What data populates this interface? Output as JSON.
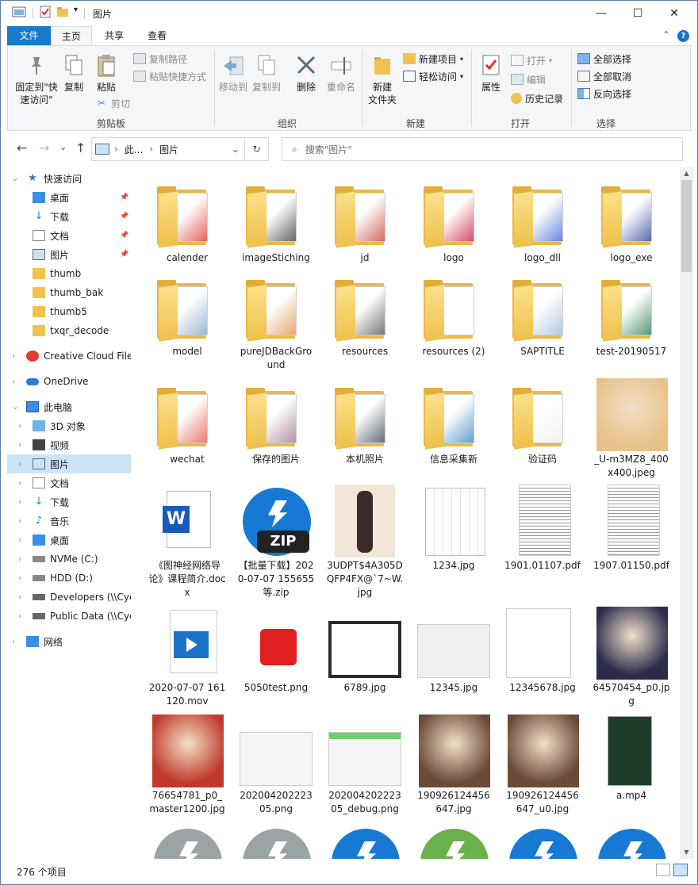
{
  "title_bar": {
    "title": "图片",
    "minimize": "—",
    "maximize": "☐",
    "close": "✕"
  },
  "ribbon_tabs": {
    "file": "文件",
    "home": "主页",
    "share": "共享",
    "view": "查看",
    "help": "?",
    "collapse": "⌃"
  },
  "ribbon": {
    "clipboard": {
      "label": "剪贴板",
      "pin_quick": "固定到\"快速访问\"",
      "copy": "复制",
      "paste": "粘贴",
      "copy_path": "复制路径",
      "paste_shortcut": "粘贴快捷方式",
      "cut": "剪切"
    },
    "organize": {
      "label": "组织",
      "move_to": "移动到",
      "copy_to": "复制到",
      "delete": "删除",
      "rename": "重命名"
    },
    "new": {
      "label": "新建",
      "new_folder": "新建\n文件夹",
      "new_item": "新建项目",
      "easy_access": "轻松访问"
    },
    "open": {
      "label": "打开",
      "properties": "属性",
      "open": "打开",
      "edit": "编辑",
      "history": "历史记录"
    },
    "select": {
      "label": "选择",
      "select_all": "全部选择",
      "select_none": "全部取消",
      "invert": "反向选择"
    }
  },
  "address": {
    "back": "←",
    "forward": "→",
    "recent": "⌄",
    "up": "↑",
    "crumb_sep": "›",
    "crumb_1": "此...",
    "crumb_2": "图片",
    "dropdown": "⌄",
    "refresh": "↻",
    "search_placeholder": "搜索\"图片\""
  },
  "nav": [
    {
      "label": "快速访问",
      "type": "quick",
      "expanded": true
    },
    {
      "label": "桌面",
      "type": "desktop",
      "pinned": true
    },
    {
      "label": "下载",
      "type": "download",
      "pinned": true
    },
    {
      "label": "文档",
      "type": "doc",
      "pinned": true
    },
    {
      "label": "图片",
      "type": "pic",
      "pinned": true
    },
    {
      "label": "thumb",
      "type": "folder"
    },
    {
      "label": "thumb_bak",
      "type": "folder"
    },
    {
      "label": "thumb5",
      "type": "folder"
    },
    {
      "label": "txqr_decode",
      "type": "folder"
    },
    {
      "label": "Creative Cloud Files",
      "type": "cc"
    },
    {
      "label": "OneDrive",
      "type": "onedrive"
    },
    {
      "label": "此电脑",
      "type": "pc",
      "expanded": true
    },
    {
      "label": "3D 对象",
      "type": "3d"
    },
    {
      "label": "视频",
      "type": "video"
    },
    {
      "label": "图片",
      "type": "pic",
      "selected": true
    },
    {
      "label": "文档",
      "type": "doc"
    },
    {
      "label": "下载",
      "type": "download"
    },
    {
      "label": "音乐",
      "type": "music"
    },
    {
      "label": "桌面",
      "type": "desktop"
    },
    {
      "label": "NVMe (C:)",
      "type": "drive"
    },
    {
      "label": "HDD (D:)",
      "type": "drive"
    },
    {
      "label": "Developers (\\\\Cyc",
      "type": "netdrive"
    },
    {
      "label": "Public Data (\\\\Cyc",
      "type": "netdrive"
    },
    {
      "label": "网络",
      "type": "network"
    }
  ],
  "items": [
    {
      "name": "calender",
      "kind": "folder",
      "accent": "#d93025"
    },
    {
      "name": "imageStiching",
      "kind": "folder",
      "accent": "#333333"
    },
    {
      "name": "jd",
      "kind": "folder",
      "accent": "#c0392b"
    },
    {
      "name": "logo",
      "kind": "folder",
      "accent": "#c8102e"
    },
    {
      "name": "logo_dll",
      "kind": "folder",
      "accent": "#3a5fcd"
    },
    {
      "name": "logo_exe",
      "kind": "folder",
      "accent": "#1f3a93"
    },
    {
      "name": "model",
      "kind": "folder",
      "accent": "#7aa0c4"
    },
    {
      "name": "pureJDBackGround",
      "kind": "folder",
      "accent": "#e08a3c"
    },
    {
      "name": "resources",
      "kind": "folder",
      "accent": "#4a4a4a"
    },
    {
      "name": "resources (2)",
      "kind": "folder",
      "accent": "#ffffff"
    },
    {
      "name": "SAPTITLE",
      "kind": "folder",
      "accent": "#9ab8d8"
    },
    {
      "name": "test-20190517",
      "kind": "folder",
      "accent": "#1e7145"
    },
    {
      "name": "wechat",
      "kind": "folder",
      "accent": "#e74c3c"
    },
    {
      "name": "保存的图片",
      "kind": "folder",
      "accent": "#9b6b8a"
    },
    {
      "name": "本机照片",
      "kind": "folder",
      "accent": "#2c3e50"
    },
    {
      "name": "信息采集新",
      "kind": "folder",
      "accent": "#2f7bbf"
    },
    {
      "name": "验证码",
      "kind": "folder",
      "accent": "#eeeeee"
    },
    {
      "name": "_U-m3MZ8_400x400.jpeg",
      "kind": "anime",
      "accent": "#e8c28a"
    },
    {
      "name": "《图神经网络导论》课程简介.docx",
      "kind": "word",
      "accent": "#185abd"
    },
    {
      "name": "【批量下载】2020-07-07 155655等.zip",
      "kind": "zip",
      "accent": "#1779d4"
    },
    {
      "name": "3UDPT$4A305DQFP4FX@`7~W.jpg",
      "kind": "figure",
      "accent": "#f2e6d9"
    },
    {
      "name": "1234.jpg",
      "kind": "calendar",
      "accent": "#d9eedb"
    },
    {
      "name": "1901.01107.pdf",
      "kind": "paper",
      "accent": "#555555"
    },
    {
      "name": "1907.01150.pdf",
      "kind": "paper",
      "accent": "#555555"
    },
    {
      "name": "2020-07-07 161120.mov",
      "kind": "video",
      "accent": "#1a73c7"
    },
    {
      "name": "5050test.png",
      "kind": "puzzle",
      "accent": "#e02020"
    },
    {
      "name": "6789.jpg",
      "kind": "screen",
      "accent": "#2b2b2b"
    },
    {
      "name": "12345.jpg",
      "kind": "screenlight",
      "accent": "#f0f0f0"
    },
    {
      "name": "12345678.jpg",
      "kind": "blank",
      "accent": "#ffffff"
    },
    {
      "name": "64570454_p0.jpg",
      "kind": "dark",
      "accent": "#2a2a4a"
    },
    {
      "name": "76654781_p0_master1200.jpg",
      "kind": "anime2",
      "accent": "#c0392b"
    },
    {
      "name": "20200420222305.png",
      "kind": "screenlight",
      "accent": "#f5f5f5"
    },
    {
      "name": "20200420222305_debug.png",
      "kind": "screengreen",
      "accent": "#6fcf6f"
    },
    {
      "name": "190926124456647.jpg",
      "kind": "brown",
      "accent": "#6b4a3a"
    },
    {
      "name": "190926124456647_u0.jpg",
      "kind": "brown",
      "accent": "#6b4a3a"
    },
    {
      "name": "a.mp4",
      "kind": "mp4",
      "accent": "#1f3d2a"
    },
    {
      "name": "",
      "kind": "round",
      "accent": "#9aa3a6"
    },
    {
      "name": "",
      "kind": "round",
      "accent": "#9aa3a6"
    },
    {
      "name": "",
      "kind": "round",
      "accent": "#1779d4"
    },
    {
      "name": "",
      "kind": "round",
      "accent": "#6ab04c"
    },
    {
      "name": "",
      "kind": "round",
      "accent": "#1779d4"
    },
    {
      "name": "",
      "kind": "round",
      "accent": "#1779d4"
    }
  ],
  "status": {
    "count": "276 个项目"
  },
  "colors": {
    "accent": "#1979ca",
    "selected": "#cce4f7",
    "folder": "#f0c24f"
  }
}
